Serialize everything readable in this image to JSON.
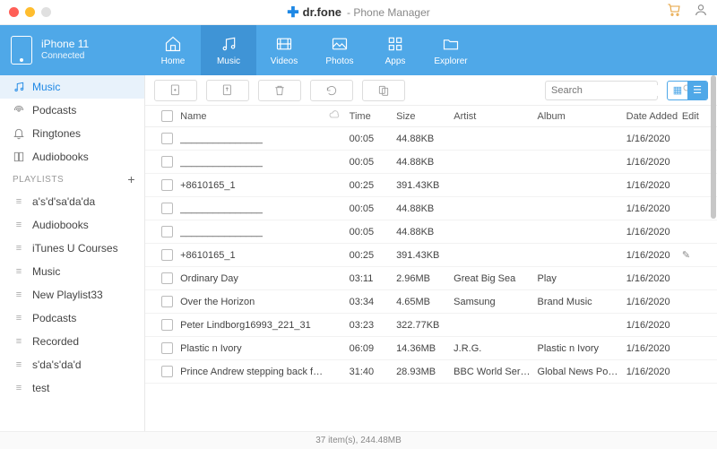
{
  "app": {
    "brand": "dr.fone",
    "suffix": "- Phone Manager"
  },
  "device": {
    "name": "iPhone 11",
    "status": "Connected"
  },
  "nav": [
    {
      "key": "home",
      "label": "Home"
    },
    {
      "key": "music",
      "label": "Music"
    },
    {
      "key": "videos",
      "label": "Videos"
    },
    {
      "key": "photos",
      "label": "Photos"
    },
    {
      "key": "apps",
      "label": "Apps"
    },
    {
      "key": "explorer",
      "label": "Explorer"
    }
  ],
  "nav_active": "music",
  "sidebar": {
    "items": [
      {
        "key": "music",
        "label": "Music",
        "icon": "music"
      },
      {
        "key": "podcasts",
        "label": "Podcasts",
        "icon": "podcast"
      },
      {
        "key": "ringtones",
        "label": "Ringtones",
        "icon": "bell"
      },
      {
        "key": "audiobooks",
        "label": "Audiobooks",
        "icon": "book"
      }
    ],
    "active": "music",
    "playlists_header": "PLAYLISTS",
    "playlists": [
      {
        "label": "a's'd'sa'da'da"
      },
      {
        "label": "Audiobooks"
      },
      {
        "label": "iTunes U Courses"
      },
      {
        "label": "Music"
      },
      {
        "label": "New Playlist33"
      },
      {
        "label": "Podcasts"
      },
      {
        "label": "Recorded"
      },
      {
        "label": "s'da's'da'd"
      },
      {
        "label": "test"
      }
    ]
  },
  "search": {
    "placeholder": "Search"
  },
  "columns": {
    "name": "Name",
    "time": "Time",
    "size": "Size",
    "artist": "Artist",
    "album": "Album",
    "date": "Date Added",
    "edit": "Edit"
  },
  "rows": [
    {
      "name": "_______________",
      "time": "00:05",
      "size": "44.88KB",
      "artist": "",
      "album": "",
      "date": "1/16/2020",
      "edit": false
    },
    {
      "name": "_______________",
      "time": "00:05",
      "size": "44.88KB",
      "artist": "",
      "album": "",
      "date": "1/16/2020",
      "edit": false
    },
    {
      "name": "+8610165_1",
      "time": "00:25",
      "size": "391.43KB",
      "artist": "",
      "album": "",
      "date": "1/16/2020",
      "edit": false
    },
    {
      "name": "_______________",
      "time": "00:05",
      "size": "44.88KB",
      "artist": "",
      "album": "",
      "date": "1/16/2020",
      "edit": false
    },
    {
      "name": "_______________",
      "time": "00:05",
      "size": "44.88KB",
      "artist": "",
      "album": "",
      "date": "1/16/2020",
      "edit": false
    },
    {
      "name": "+8610165_1",
      "time": "00:25",
      "size": "391.43KB",
      "artist": "",
      "album": "",
      "date": "1/16/2020",
      "edit": true
    },
    {
      "name": "Ordinary Day",
      "time": "03:11",
      "size": "2.96MB",
      "artist": "Great Big Sea",
      "album": "Play",
      "date": "1/16/2020",
      "edit": false
    },
    {
      "name": "Over the Horizon",
      "time": "03:34",
      "size": "4.65MB",
      "artist": "Samsung",
      "album": "Brand Music",
      "date": "1/16/2020",
      "edit": false
    },
    {
      "name": "Peter Lindborg16993_221_31",
      "time": "03:23",
      "size": "322.77KB",
      "artist": "",
      "album": "",
      "date": "1/16/2020",
      "edit": false
    },
    {
      "name": "Plastic n Ivory",
      "time": "06:09",
      "size": "14.36MB",
      "artist": "J.R.G.",
      "album": "Plastic n Ivory",
      "date": "1/16/2020",
      "edit": false
    },
    {
      "name": "Prince Andrew stepping back fro...",
      "time": "31:40",
      "size": "28.93MB",
      "artist": "BBC World Service",
      "album": "Global News Podc...",
      "date": "1/16/2020",
      "edit": false
    }
  ],
  "status": "37 item(s), 244.48MB"
}
